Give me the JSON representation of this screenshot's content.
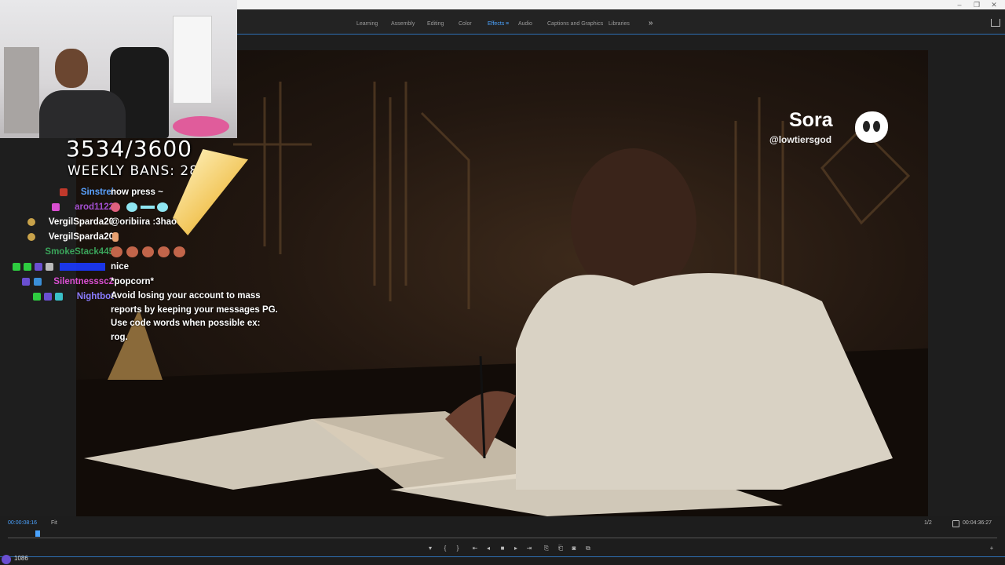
{
  "workspace_tabs": [
    {
      "label": "Learning",
      "active": false
    },
    {
      "label": "Assembly",
      "active": false
    },
    {
      "label": "Editing",
      "active": false
    },
    {
      "label": "Color",
      "active": false
    },
    {
      "label": "Effects",
      "active": true
    },
    {
      "label": "Audio",
      "active": false
    },
    {
      "label": "Captions and Graphics",
      "active": false
    },
    {
      "label": "Libraries",
      "active": false
    }
  ],
  "more_tabs_glyph": "»",
  "window_controls": {
    "minimize": "–",
    "restore": "❐",
    "close": "✕"
  },
  "video": {
    "watermark_brand": "Sora",
    "watermark_handle": "@lowtiersgod"
  },
  "overlay": {
    "counter": "3534/3600",
    "weekly_bans": "WEEKLY BANS: 287"
  },
  "chat": [
    {
      "name": "Sinstrel",
      "color": "#5aa2ff",
      "message": "now press ~"
    },
    {
      "name": "arod1122",
      "color": "#a34fd1",
      "message": ""
    },
    {
      "name": "VergilSparda20",
      "color": "#ffffff",
      "message": "@oribiira :3hao"
    },
    {
      "name": "VergilSparda20",
      "color": "#ffffff",
      "message": ""
    },
    {
      "name": "SmokeStack445",
      "color": "#3aa35a",
      "message": ""
    },
    {
      "name": "",
      "color": "#1b3aff",
      "message": "nice"
    },
    {
      "name": "Silentnesssc2",
      "color": "#d94fd1",
      "message": "*popcorn*"
    },
    {
      "name": "Nightbot",
      "color": "#8a7cff",
      "message": "Avoid losing your account to mass\nreports by keeping your messages PG.\nUse code words when possible ex:\nrog."
    }
  ],
  "transport": {
    "current_timecode": "00:00:08:16",
    "fit_label": "Fit",
    "resolution": "1/2",
    "duration_timecode": "00:04:36:27",
    "playhead_position": 0.03
  },
  "viewer_count": "1086",
  "icons": [
    "share-icon",
    "wrench-icon",
    "add-button-icon",
    "camera-icon",
    "stop-icon",
    "step-back-icon",
    "step-forward-icon",
    "marker-icon",
    "in-point-icon",
    "out-point-icon"
  ]
}
